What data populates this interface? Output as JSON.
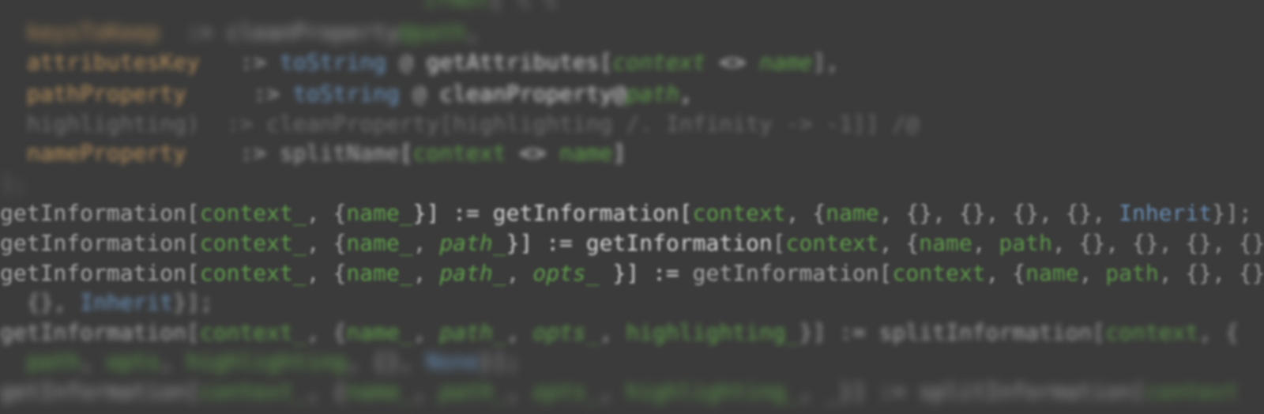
{
  "code_lines": [
    {
      "id": "line-1",
      "blur": "strong",
      "top": 0,
      "left": 0,
      "segments": [
        {
          "text": "                              ",
          "cls": "c-plain"
        },
        {
          "text": "ifNot",
          "cls": "c-green"
        },
        {
          "text": "[ ",
          "cls": "c-plain"
        },
        {
          "text": "\\ \\",
          "cls": "c-plain"
        }
      ]
    },
    {
      "id": "line-2",
      "blur": "strong",
      "segments": [
        {
          "text": "  ",
          "cls": "c-plain"
        },
        {
          "text": "keysToKeep",
          "cls": "c-orange"
        },
        {
          "text": "  :> ",
          "cls": "c-plain"
        },
        {
          "text": "cleanProperty",
          "cls": "c-plain"
        },
        {
          "text": "@path",
          "cls": "c-green"
        },
        {
          "text": ",",
          "cls": "c-plain"
        }
      ]
    },
    {
      "id": "line-3",
      "blur": "med",
      "segments": [
        {
          "text": "  ",
          "cls": "c-plain"
        },
        {
          "text": "attributesKey",
          "cls": "c-orange"
        },
        {
          "text": "   :> ",
          "cls": "c-plain"
        },
        {
          "text": "toString",
          "cls": "c-blue"
        },
        {
          "text": " @ ",
          "cls": "c-plain"
        },
        {
          "text": "getAttributes",
          "cls": "c-bright"
        },
        {
          "text": "[",
          "cls": "c-bright"
        },
        {
          "text": "context",
          "cls": "c-green c-it"
        },
        {
          "text": " <> ",
          "cls": "c-bright c-it"
        },
        {
          "text": "name",
          "cls": "c-green c-it"
        },
        {
          "text": "],",
          "cls": "c-plain"
        }
      ]
    },
    {
      "id": "line-4",
      "blur": "med",
      "segments": [
        {
          "text": "  ",
          "cls": "c-plain"
        },
        {
          "text": "pathProperty",
          "cls": "c-orange"
        },
        {
          "text": "     :> ",
          "cls": "c-plain"
        },
        {
          "text": "toString",
          "cls": "c-blue"
        },
        {
          "text": " @ ",
          "cls": "c-plain"
        },
        {
          "text": "cleanProperty@",
          "cls": "c-bright"
        },
        {
          "text": "path",
          "cls": "c-green c-it"
        },
        {
          "text": ",",
          "cls": "c-bright"
        }
      ]
    },
    {
      "id": "line-5",
      "blur": "med",
      "segments": [
        {
          "text": "  highlighting)  :> cleanProperty[highlighting /. Infinity -> -1]] /@",
          "cls": "c-dim"
        }
      ]
    },
    {
      "id": "line-6",
      "blur": "med",
      "segments": [
        {
          "text": "  ",
          "cls": "c-plain"
        },
        {
          "text": "nameProperty",
          "cls": "c-orange"
        },
        {
          "text": "    :> ",
          "cls": "c-plain"
        },
        {
          "text": "splitName",
          "cls": "c-plain"
        },
        {
          "text": "[",
          "cls": "c-bright"
        },
        {
          "text": "context",
          "cls": "c-green"
        },
        {
          "text": " <> ",
          "cls": "c-bright"
        },
        {
          "text": "name",
          "cls": "c-green"
        },
        {
          "text": "]",
          "cls": "c-bright"
        }
      ]
    },
    {
      "id": "line-7",
      "blur": "strong",
      "segments": [
        {
          "text": "];",
          "cls": "c-dim"
        }
      ]
    },
    {
      "id": "line-8",
      "blur": "soft",
      "segments": [
        {
          "text": "getInformation",
          "cls": "c-plain"
        },
        {
          "text": "[",
          "cls": "c-plain"
        },
        {
          "text": "context_",
          "cls": "c-green"
        },
        {
          "text": ", {",
          "cls": "c-plain"
        },
        {
          "text": "name_",
          "cls": "c-green"
        },
        {
          "text": "}] := ",
          "cls": "c-bright"
        },
        {
          "text": "getInformation",
          "cls": "c-bright"
        },
        {
          "text": "[",
          "cls": "c-bright"
        },
        {
          "text": "context",
          "cls": "c-green"
        },
        {
          "text": ", {",
          "cls": "c-plain"
        },
        {
          "text": "name",
          "cls": "c-green"
        },
        {
          "text": ", {}, {}, {}, {}, ",
          "cls": "c-plain"
        },
        {
          "text": "Inherit",
          "cls": "c-blue"
        },
        {
          "text": "}];",
          "cls": "c-plain"
        }
      ]
    },
    {
      "id": "line-9",
      "blur": "soft",
      "segments": [
        {
          "text": "getInformation",
          "cls": "c-plain"
        },
        {
          "text": "[",
          "cls": "c-plain"
        },
        {
          "text": "context_",
          "cls": "c-green"
        },
        {
          "text": ", {",
          "cls": "c-plain"
        },
        {
          "text": "name_",
          "cls": "c-green"
        },
        {
          "text": ", ",
          "cls": "c-plain"
        },
        {
          "text": "path_",
          "cls": "c-green c-it"
        },
        {
          "text": "}] := ",
          "cls": "c-bright"
        },
        {
          "text": "getInformation",
          "cls": "c-bright"
        },
        {
          "text": "[",
          "cls": "c-plain"
        },
        {
          "text": "context",
          "cls": "c-green"
        },
        {
          "text": ", {",
          "cls": "c-plain"
        },
        {
          "text": "name",
          "cls": "c-green"
        },
        {
          "text": ", ",
          "cls": "c-plain"
        },
        {
          "text": "path",
          "cls": "c-green"
        },
        {
          "text": ", {}, {}, {}, {}",
          "cls": "c-plain"
        }
      ]
    },
    {
      "id": "line-10",
      "blur": "soft",
      "segments": [
        {
          "text": "getInformation",
          "cls": "c-plain"
        },
        {
          "text": "[",
          "cls": "c-plain"
        },
        {
          "text": "context_",
          "cls": "c-green"
        },
        {
          "text": ", {",
          "cls": "c-plain"
        },
        {
          "text": "name_",
          "cls": "c-green"
        },
        {
          "text": ", ",
          "cls": "c-plain"
        },
        {
          "text": "path_",
          "cls": "c-green c-it"
        },
        {
          "text": ", ",
          "cls": "c-plain"
        },
        {
          "text": "opts_",
          "cls": "c-green c-it"
        },
        {
          "text": " }] := ",
          "cls": "c-bright"
        },
        {
          "text": "getInformation",
          "cls": "c-plain"
        },
        {
          "text": "[",
          "cls": "c-plain"
        },
        {
          "text": "context",
          "cls": "c-green"
        },
        {
          "text": ", {",
          "cls": "c-plain"
        },
        {
          "text": "name",
          "cls": "c-green"
        },
        {
          "text": ", ",
          "cls": "c-plain"
        },
        {
          "text": "path",
          "cls": "c-green"
        },
        {
          "text": ", {}, {}",
          "cls": "c-plain"
        }
      ]
    },
    {
      "id": "line-11",
      "blur": "med",
      "segments": [
        {
          "text": "  {}, ",
          "cls": "c-plain"
        },
        {
          "text": "Inherit",
          "cls": "c-blue"
        },
        {
          "text": "}];",
          "cls": "c-plain"
        }
      ]
    },
    {
      "id": "line-12",
      "blur": "med",
      "segments": [
        {
          "text": "getInformation",
          "cls": "c-plain"
        },
        {
          "text": "[",
          "cls": "c-plain"
        },
        {
          "text": "context_",
          "cls": "c-green"
        },
        {
          "text": ", {",
          "cls": "c-plain"
        },
        {
          "text": "name_",
          "cls": "c-green"
        },
        {
          "text": ", ",
          "cls": "c-plain"
        },
        {
          "text": "path_",
          "cls": "c-green c-it"
        },
        {
          "text": ", ",
          "cls": "c-plain"
        },
        {
          "text": "opts_",
          "cls": "c-green c-it"
        },
        {
          "text": ", ",
          "cls": "c-plain"
        },
        {
          "text": "highlighting_",
          "cls": "c-green"
        },
        {
          "text": "}] := ",
          "cls": "c-plain"
        },
        {
          "text": "splitInformation",
          "cls": "c-plain"
        },
        {
          "text": "[",
          "cls": "c-plain"
        },
        {
          "text": "context",
          "cls": "c-green"
        },
        {
          "text": ", {",
          "cls": "c-plain"
        }
      ]
    },
    {
      "id": "line-13",
      "blur": "strong",
      "segments": [
        {
          "text": "  ",
          "cls": "c-plain"
        },
        {
          "text": "path",
          "cls": "c-green"
        },
        {
          "text": ", ",
          "cls": "c-plain"
        },
        {
          "text": "opts",
          "cls": "c-green"
        },
        {
          "text": ", ",
          "cls": "c-plain"
        },
        {
          "text": "highlighting",
          "cls": "c-green"
        },
        {
          "text": ", {}, ",
          "cls": "c-plain"
        },
        {
          "text": "None",
          "cls": "c-blue"
        },
        {
          "text": "}];",
          "cls": "c-plain"
        }
      ]
    },
    {
      "id": "line-14",
      "blur": "strong",
      "segments": [
        {
          "text": "getInformation",
          "cls": "c-plain"
        },
        {
          "text": "[",
          "cls": "c-plain"
        },
        {
          "text": "context_",
          "cls": "c-green"
        },
        {
          "text": ", {",
          "cls": "c-plain"
        },
        {
          "text": "name_",
          "cls": "c-green"
        },
        {
          "text": ", ",
          "cls": "c-plain"
        },
        {
          "text": "path_",
          "cls": "c-green c-it"
        },
        {
          "text": ", ",
          "cls": "c-plain"
        },
        {
          "text": "opts_",
          "cls": "c-green c-it"
        },
        {
          "text": ", ",
          "cls": "c-plain"
        },
        {
          "text": "highlighting_",
          "cls": "c-green"
        },
        {
          "text": ", _}] := ",
          "cls": "c-plain"
        },
        {
          "text": "splitInformation",
          "cls": "c-plain"
        },
        {
          "text": "[",
          "cls": "c-plain"
        },
        {
          "text": "context",
          "cls": "c-green"
        }
      ]
    }
  ]
}
